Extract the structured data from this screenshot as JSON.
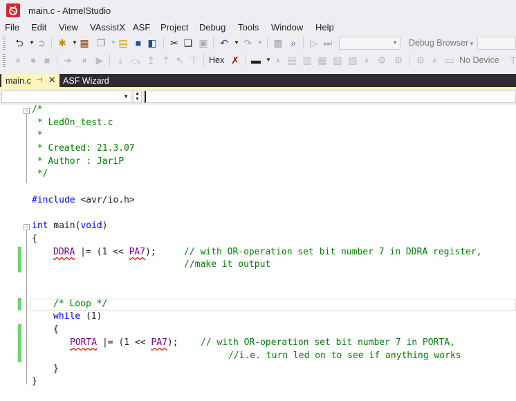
{
  "window": {
    "title": "main.c - AtmelStudio"
  },
  "menu": [
    "File",
    "Edit",
    "View",
    "VAssistX",
    "ASF",
    "Project",
    "Debug",
    "Tools",
    "Window",
    "Help"
  ],
  "toolbar": {
    "debug_browser_label": "Debug Browser",
    "hex_label": "Hex",
    "no_device_label": "No Device"
  },
  "tabs": [
    {
      "label": "main.c",
      "active": true
    },
    {
      "label": "ASF Wizard",
      "active": false
    }
  ],
  "code": {
    "l1": "/*",
    "l2": " * LedOn_test.c",
    "l3": " *",
    "l4": " * Created: 21.3.07",
    "l5": " * Author : JariP",
    "l6": " */",
    "include_kw": "#include",
    "include_file": " <avr/io.h>",
    "int_kw": "int",
    "main_fn": " main(",
    "void_kw": "void",
    "close_paren": ")",
    "open_brace": "{",
    "ddra": "DDRA",
    "ddra_rest_1": " |= (1 << ",
    "pa7": "PA7",
    "ddra_rest_2": ");",
    "ddra_comment": "// with OR-operation set bit number 7 in DDRA register,",
    "ddra_comment2": "//make it output",
    "loop_comment": "/* Loop */",
    "while_kw": "while",
    "while_rest": " (1)",
    "inner_open": "{",
    "porta": "PORTA",
    "porta_rest_1": " |= (1 << ",
    "pa7_2": "PA7",
    "porta_rest_2": ");",
    "porta_comment": "// with OR-operation set bit number 7 in PORTA,",
    "porta_comment2": "//i.e. turn led on to see if anything works",
    "inner_close": "}",
    "close_brace": "}"
  },
  "colors": {
    "comment": "#008000",
    "keyword": "#0000ff",
    "preprocessor": "#808080",
    "change_marker": "#6cd46c",
    "active_tab": "#fdf4bf",
    "tab_strip": "#2d2d30",
    "app_icon": "#d9262c"
  }
}
